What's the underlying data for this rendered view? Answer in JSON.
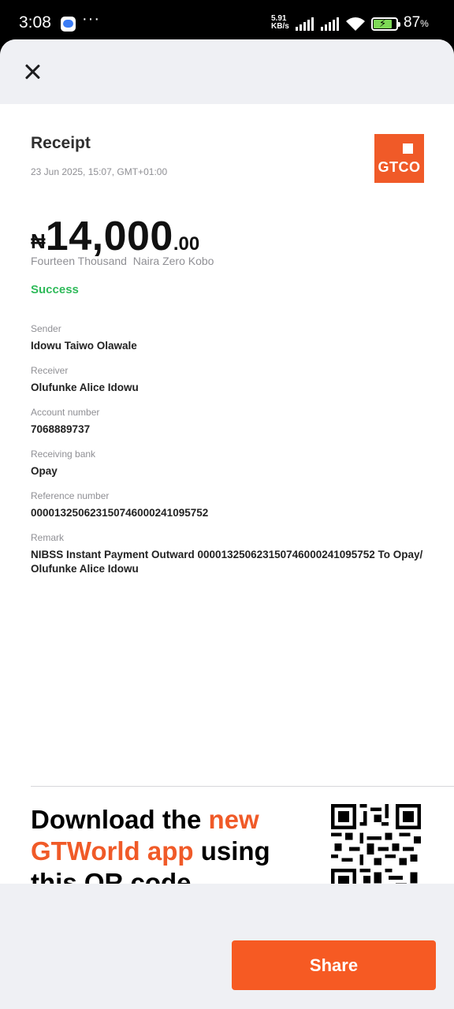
{
  "status_bar": {
    "time": "3:08",
    "speed_value": "5.91",
    "speed_unit": "KB/s",
    "battery_percent": "87",
    "battery_suffix": "%"
  },
  "receipt": {
    "title": "Receipt",
    "date": "23 Jun 2025, 15:07, GMT+01:00",
    "logo_text": "GTCO",
    "currency_symbol": "₦",
    "amount_main": "14,000",
    "amount_decimal": ".00",
    "amount_words": "Fourteen Thousand  Naira Zero Kobo",
    "status": "Success",
    "fields": [
      {
        "label": "Sender",
        "value": "Idowu Taiwo Olawale"
      },
      {
        "label": "Receiver",
        "value": "Olufunke Alice Idowu"
      },
      {
        "label": "Account number",
        "value": "7068889737"
      },
      {
        "label": "Receiving bank",
        "value": "Opay"
      },
      {
        "label": "Reference number",
        "value": "000013250623150746000241095752"
      },
      {
        "label": "Remark",
        "value": "NIBSS Instant Payment Outward 000013250623150746000241095752  To Opay/ Olufunke Alice Idowu"
      }
    ]
  },
  "promo": {
    "part1": "Download the ",
    "highlight1": "new GTWorld app",
    "part2": " using this QR code"
  },
  "footer": {
    "share_label": "Share"
  },
  "colors": {
    "brand_orange": "#f05a28",
    "success_green": "#2fba5a",
    "header_gray": "#eff0f4"
  }
}
